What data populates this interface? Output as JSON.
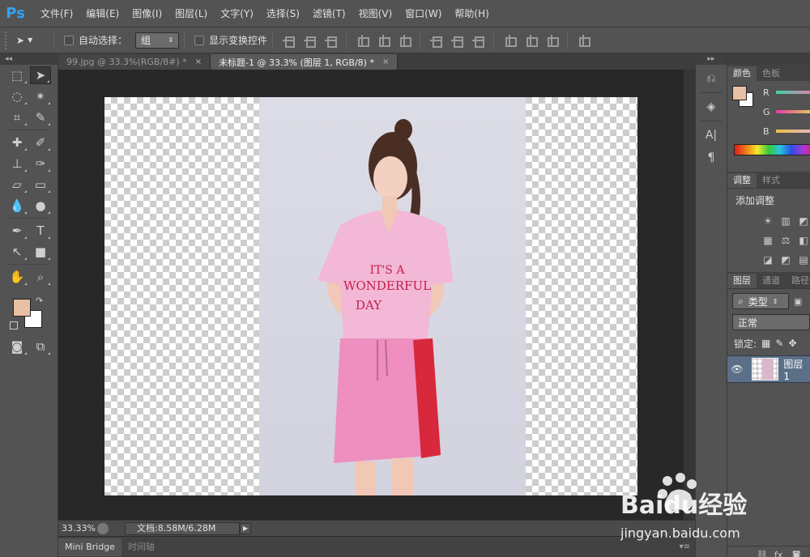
{
  "app": {
    "logo": "Ps"
  },
  "menu": [
    "文件(F)",
    "编辑(E)",
    "图像(I)",
    "图层(L)",
    "文字(Y)",
    "选择(S)",
    "滤镜(T)",
    "视图(V)",
    "窗口(W)",
    "帮助(H)"
  ],
  "options": {
    "auto_select_label": "自动选择：",
    "auto_select_value": "组",
    "show_transform_label": "显示变换控件"
  },
  "tabs": [
    {
      "label": "99.jpg @ 33.3%(RGB/8#) *",
      "close": "×"
    },
    {
      "label": "未标题-1 @ 33.3% (图层 1, RGB/8) *",
      "close": "×"
    }
  ],
  "status": {
    "zoom": "33.33%",
    "doc_size": "文档:8.58M/6.28M",
    "arrow": "▶"
  },
  "bottom_tabs": [
    "Mini Bridge",
    "时间轴"
  ],
  "colors": {
    "foreground": "#e8c0a6",
    "background": "#ffffff"
  },
  "color_panel": {
    "tabs": [
      "颜色",
      "色板"
    ],
    "r_label": "R",
    "g_label": "G",
    "b_label": "B"
  },
  "adjust_panel": {
    "tabs": [
      "调整",
      "样式"
    ],
    "title": "添加调整"
  },
  "layers_panel": {
    "tabs": [
      "图层",
      "通道",
      "路径"
    ],
    "filter_label": "类型",
    "blend_mode": "正常",
    "lock_label": "锁定:",
    "layer_name": "图层 1"
  },
  "photo_text": {
    "line1": "IT'S A",
    "line2": "WONDERFUL",
    "line3": "DAY"
  },
  "watermark": {
    "brand": "Baidu经验",
    "url": "jingyan.baidu.com"
  }
}
